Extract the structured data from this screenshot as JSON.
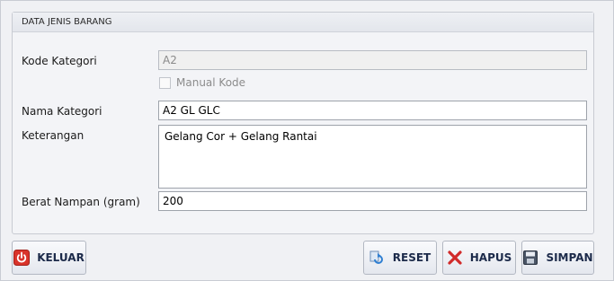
{
  "group": {
    "title": "DATA JENIS BARANG"
  },
  "form": {
    "kode_label": "Kode Kategori",
    "kode_value": "A2",
    "manual_kode_label": "Manual Kode",
    "nama_label": "Nama Kategori",
    "nama_value": "A2 GL GLC",
    "keterangan_label": "Keterangan",
    "keterangan_value": "Gelang Cor + Gelang Rantai",
    "berat_label": "Berat Nampan (gram)",
    "berat_value": "200"
  },
  "buttons": {
    "keluar": "KELUAR",
    "reset": "RESET",
    "hapus": "HAPUS",
    "simpan": "SIMPAN"
  },
  "icons": {
    "keluar": "power-icon",
    "reset": "refresh-icon",
    "hapus": "delete-x-icon",
    "simpan": "save-disk-icon"
  },
  "colors": {
    "power": "#d9342b",
    "delete": "#d12a2a",
    "button_text": "#1c2a4a"
  }
}
